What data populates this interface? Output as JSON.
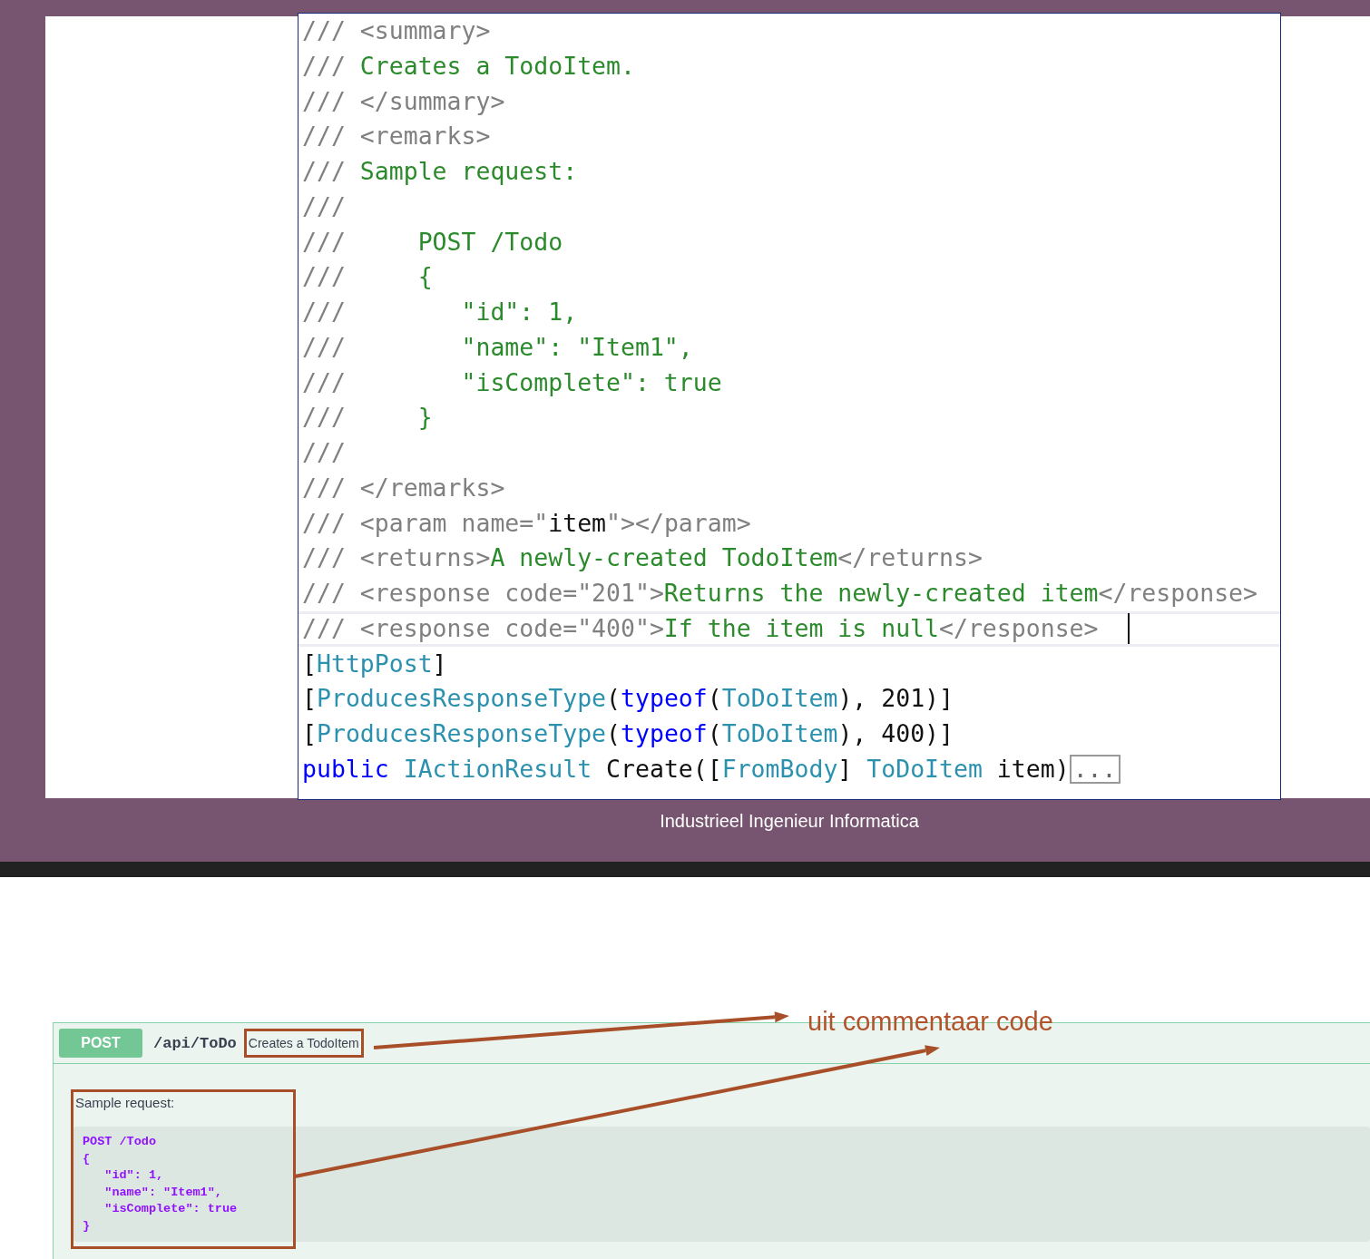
{
  "code_lines": [
    {
      "current": false,
      "segments": [
        {
          "kind": "comment",
          "text": "/// <summary>"
        }
      ]
    },
    {
      "current": false,
      "segments": [
        {
          "kind": "comment",
          "text": "/// "
        },
        {
          "kind": "doc",
          "text": "Creates a TodoItem."
        }
      ]
    },
    {
      "current": false,
      "segments": [
        {
          "kind": "comment",
          "text": "/// </summary>"
        }
      ]
    },
    {
      "current": false,
      "segments": [
        {
          "kind": "comment",
          "text": "/// <remarks>"
        }
      ]
    },
    {
      "current": false,
      "segments": [
        {
          "kind": "comment",
          "text": "/// "
        },
        {
          "kind": "doc",
          "text": "Sample request:"
        }
      ]
    },
    {
      "current": false,
      "segments": [
        {
          "kind": "comment",
          "text": "///"
        }
      ]
    },
    {
      "current": false,
      "segments": [
        {
          "kind": "comment",
          "text": "///     "
        },
        {
          "kind": "doc",
          "text": "POST /Todo"
        }
      ]
    },
    {
      "current": false,
      "segments": [
        {
          "kind": "comment",
          "text": "///     "
        },
        {
          "kind": "doc",
          "text": "{"
        }
      ]
    },
    {
      "current": false,
      "segments": [
        {
          "kind": "comment",
          "text": "///        "
        },
        {
          "kind": "doc",
          "text": "\"id\": 1,"
        }
      ]
    },
    {
      "current": false,
      "segments": [
        {
          "kind": "comment",
          "text": "///        "
        },
        {
          "kind": "doc",
          "text": "\"name\": \"Item1\","
        }
      ]
    },
    {
      "current": false,
      "segments": [
        {
          "kind": "comment",
          "text": "///        "
        },
        {
          "kind": "doc",
          "text": "\"isComplete\": true"
        }
      ]
    },
    {
      "current": false,
      "segments": [
        {
          "kind": "comment",
          "text": "///     "
        },
        {
          "kind": "doc",
          "text": "}"
        }
      ]
    },
    {
      "current": false,
      "segments": [
        {
          "kind": "comment",
          "text": "///"
        }
      ]
    },
    {
      "current": false,
      "segments": [
        {
          "kind": "comment",
          "text": "/// </remarks>"
        }
      ]
    },
    {
      "current": false,
      "segments": [
        {
          "kind": "comment",
          "text": "/// <param name=\""
        },
        {
          "kind": "plain",
          "text": "item"
        },
        {
          "kind": "comment",
          "text": "\"></param>"
        }
      ]
    },
    {
      "current": false,
      "segments": [
        {
          "kind": "comment",
          "text": "/// <returns>"
        },
        {
          "kind": "doc",
          "text": "A newly-created TodoItem"
        },
        {
          "kind": "comment",
          "text": "</returns>"
        }
      ]
    },
    {
      "current": false,
      "segments": [
        {
          "kind": "comment",
          "text": "/// <response code=\"201\">"
        },
        {
          "kind": "doc",
          "text": "Returns the newly-created item"
        },
        {
          "kind": "comment",
          "text": "</response>"
        }
      ]
    },
    {
      "current": true,
      "segments": [
        {
          "kind": "comment",
          "text": "/// <response code=\"400\">"
        },
        {
          "kind": "doc",
          "text": "If the item is null"
        },
        {
          "kind": "comment",
          "text": "</response>"
        }
      ]
    },
    {
      "current": false,
      "segments": [
        {
          "kind": "plain",
          "text": "["
        },
        {
          "kind": "type",
          "text": "HttpPost"
        },
        {
          "kind": "plain",
          "text": "]"
        }
      ]
    },
    {
      "current": false,
      "segments": [
        {
          "kind": "plain",
          "text": "["
        },
        {
          "kind": "type",
          "text": "ProducesResponseType"
        },
        {
          "kind": "plain",
          "text": "("
        },
        {
          "kind": "keyword",
          "text": "typeof"
        },
        {
          "kind": "plain",
          "text": "("
        },
        {
          "kind": "type",
          "text": "ToDoItem"
        },
        {
          "kind": "plain",
          "text": "), 201)]"
        }
      ]
    },
    {
      "current": false,
      "segments": [
        {
          "kind": "plain",
          "text": "["
        },
        {
          "kind": "type",
          "text": "ProducesResponseType"
        },
        {
          "kind": "plain",
          "text": "("
        },
        {
          "kind": "keyword",
          "text": "typeof"
        },
        {
          "kind": "plain",
          "text": "("
        },
        {
          "kind": "type",
          "text": "ToDoItem"
        },
        {
          "kind": "plain",
          "text": "), 400)]"
        }
      ]
    },
    {
      "current": false,
      "collapsed": "...",
      "segments": [
        {
          "kind": "keyword",
          "text": "public "
        },
        {
          "kind": "type",
          "text": "IActionResult"
        },
        {
          "kind": "plain",
          "text": " Create(["
        },
        {
          "kind": "type",
          "text": "FromBody"
        },
        {
          "kind": "plain",
          "text": "] "
        },
        {
          "kind": "type",
          "text": "ToDoItem"
        },
        {
          "kind": "plain",
          "text": " item)"
        }
      ]
    }
  ],
  "slide_footer": "Industrieel Ingenieur Informatica",
  "swagger": {
    "method": "POST",
    "path": "/api/ToDo",
    "summary": "Creates a TodoItem",
    "description": "Sample request:",
    "sample": [
      "POST /Todo",
      "{",
      "   \"id\": 1,",
      "   \"name\": \"Item1\",",
      "   \"isComplete\": true",
      "}"
    ]
  },
  "annotation": {
    "label": "uit commentaar code"
  }
}
